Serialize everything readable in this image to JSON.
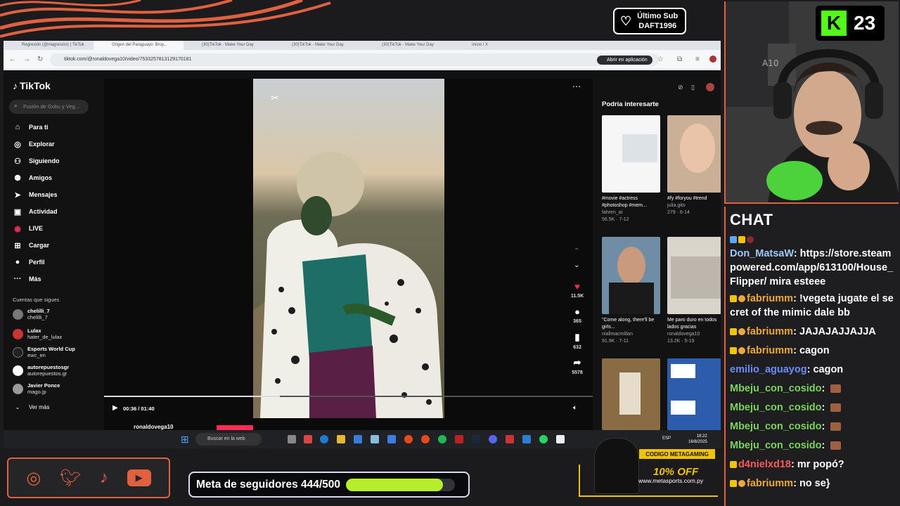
{
  "follow_alert": {
    "line1": "Último Sub",
    "line2": "DAFT1996"
  },
  "browser": {
    "tabs": [
      "Regresión (@nlagresión) | TikTok",
      "Origen del Paraguayo: Bruy...",
      "(30)TikTok - Make Your Day",
      "(30)TikTok - Make Your Day",
      "(30)TikTok - Make Your Day",
      "Inicio / X"
    ],
    "url": "tiktok.com/@ronaldovega10/video/7533257813129170181",
    "open_app": "Abrir en aplicación"
  },
  "tiktok": {
    "logo": "TikTok",
    "search_placeholder": "Fusión de Goku y Veg...",
    "nav": [
      {
        "label": "Para ti",
        "icon": "home-icon"
      },
      {
        "label": "Explorar",
        "icon": "compass-icon"
      },
      {
        "label": "Siguiendo",
        "icon": "following-icon"
      },
      {
        "label": "Amigos",
        "icon": "friends-icon"
      },
      {
        "label": "Mensajes",
        "icon": "messages-icon"
      },
      {
        "label": "Actividad",
        "icon": "activity-icon"
      },
      {
        "label": "LIVE",
        "icon": "live-icon"
      },
      {
        "label": "Cargar",
        "icon": "upload-icon"
      },
      {
        "label": "Perfil",
        "icon": "profile-icon"
      },
      {
        "label": "Más",
        "icon": "more-icon"
      }
    ],
    "follows_heading": "Cuentas que sigues",
    "follows": [
      {
        "name": "chelilli_7",
        "handle": "chelilli_7"
      },
      {
        "name": "Lulax",
        "handle": "hater_de_lulax"
      },
      {
        "name": "Esports World Cup",
        "handle": "ewc_en"
      },
      {
        "name": "autorepuestosgr",
        "handle": "autorepuestos.gr"
      },
      {
        "name": "Javier Ponce",
        "handle": "mago.jp"
      }
    ],
    "see_more": "Ver más",
    "video": {
      "time": "00:36 / 01:40",
      "progress": 0.36,
      "author": "ronaldovega10"
    },
    "actions": {
      "likes": "11.5K",
      "comments": "365",
      "saves": "632",
      "shares": "5578"
    },
    "suggestions_title": "Podría interesarte",
    "suggestions": [
      {
        "caption": "#movie #actress #photoshop #mem...",
        "user": "fahren_ai",
        "stats": "56.5K · 7-12"
      },
      {
        "caption": "#fy #foryou #trend",
        "user": "julia.gito",
        "stats": "279 · 6-14"
      },
      {
        "caption": "\"Come along, there'll be girls...",
        "user": "niallmacmillan",
        "stats": "91.9K · 7-11"
      },
      {
        "caption": "Me paro duro en todos lados gracias",
        "user": "ronaldovega10",
        "stats": "13.2K · 5-19"
      }
    ]
  },
  "taskbar": {
    "search": "Buscar en la web",
    "lang": "ESP",
    "time": "18:22",
    "date": "16/8/2025"
  },
  "goal": {
    "label": "Meta de seguidores 444/500",
    "current": 444,
    "target": 500
  },
  "sponsor": {
    "code": "CODIGO METAGAMING",
    "discount": "10% OFF",
    "site": "www.metasports.com.py"
  },
  "badge": {
    "count": "23"
  },
  "chat": {
    "title": "CHAT",
    "messages": [
      {
        "user": "Don_MatsaW",
        "color": "#9ec9ff",
        "text": "https://store.steampowered.com/app/613100/House_Flipper/ mira esteee"
      },
      {
        "user": "fabriumm",
        "color": "#f0a83c",
        "text": "!vegeta jugate el secret of the mimic dale bb"
      },
      {
        "user": "fabriumm",
        "color": "#f0a83c",
        "text": "JAJAJAJJAJJA"
      },
      {
        "user": "fabriumm",
        "color": "#f0a83c",
        "text": "cagon"
      },
      {
        "user": "emilio_aguayog",
        "color": "#6b8cff",
        "text": "cagon"
      },
      {
        "user": "Mbeju_con_cosido",
        "color": "#7bd35a",
        "text": ""
      },
      {
        "user": "Mbeju_con_cosido",
        "color": "#7bd35a",
        "text": ""
      },
      {
        "user": "Mbeju_con_cosido",
        "color": "#7bd35a",
        "text": ""
      },
      {
        "user": "Mbeju_con_cosido",
        "color": "#7bd35a",
        "text": ""
      },
      {
        "user": "d4nielxd18",
        "color": "#ff5a5a",
        "text": "mr popó?"
      },
      {
        "user": "fabriumm",
        "color": "#f0a83c",
        "text": "no se}"
      }
    ]
  },
  "colors": {
    "accent": "#e0603f",
    "goal_fill": "#b6ee2c",
    "tiktok_red": "#fe2c55"
  }
}
